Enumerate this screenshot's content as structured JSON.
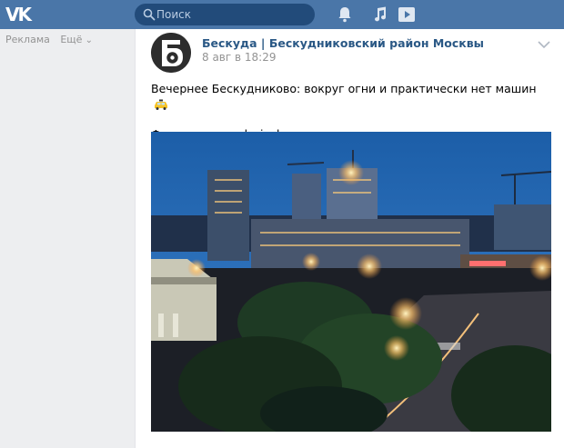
{
  "topbar": {
    "logo_text": "VK",
    "search_placeholder": "Поиск",
    "icons": [
      "bell-icon",
      "music-icon",
      "video-icon"
    ],
    "brand_color": "#4a76a8"
  },
  "left": {
    "ads_label": "Реклама",
    "more_label": "Ещё"
  },
  "post": {
    "avatar_letter": "Б",
    "author": "Бескуда | Бескудниковский район Москвы",
    "date": "8 авг в 18:29",
    "text_line1": "Вечернее Бескудниково: вокруг огни и практически нет машин",
    "text_line2": "Фото из инст: ula_jackson",
    "emoji": "taxi-icon",
    "menu_icon": "chevron-down-icon"
  }
}
